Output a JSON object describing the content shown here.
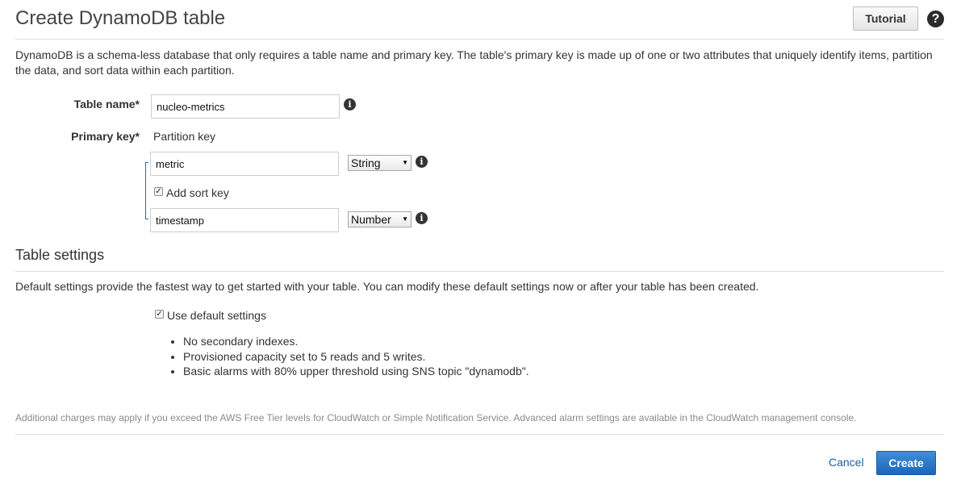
{
  "header": {
    "title": "Create DynamoDB table",
    "tutorial_label": "Tutorial",
    "help_icon": "question-circle-icon"
  },
  "intro": "DynamoDB is a schema-less database that only requires a table name and primary key. The table's primary key is made up of one or two attributes that uniquely identify items, partition the data, and sort data within each partition.",
  "form": {
    "table_name_label": "Table name*",
    "table_name_value": "nucleo-metrics",
    "primary_key_label": "Primary key*",
    "partition_key_label": "Partition key",
    "partition_key_value": "metric",
    "partition_key_type": "String",
    "add_sort_key_label": "Add sort key",
    "add_sort_key_checked": true,
    "sort_key_value": "timestamp",
    "sort_key_type": "Number"
  },
  "settings": {
    "title": "Table settings",
    "description": "Default settings provide the fastest way to get started with your table. You can modify these default settings now or after your table has been created.",
    "use_default_label": "Use default settings",
    "use_default_checked": true,
    "bullets": [
      "No secondary indexes.",
      "Provisioned capacity set to 5 reads and 5 writes.",
      "Basic alarms with 80% upper threshold using SNS topic \"dynamodb\"."
    ]
  },
  "footnote": "Additional charges may apply if you exceed the AWS Free Tier levels for CloudWatch or Simple Notification Service. Advanced alarm settings are available in the CloudWatch management console.",
  "actions": {
    "cancel_label": "Cancel",
    "create_label": "Create"
  },
  "colors": {
    "primary_button": "#1b66b8",
    "link": "#1a5f9e",
    "key_bracket": "#1f6fbf"
  }
}
